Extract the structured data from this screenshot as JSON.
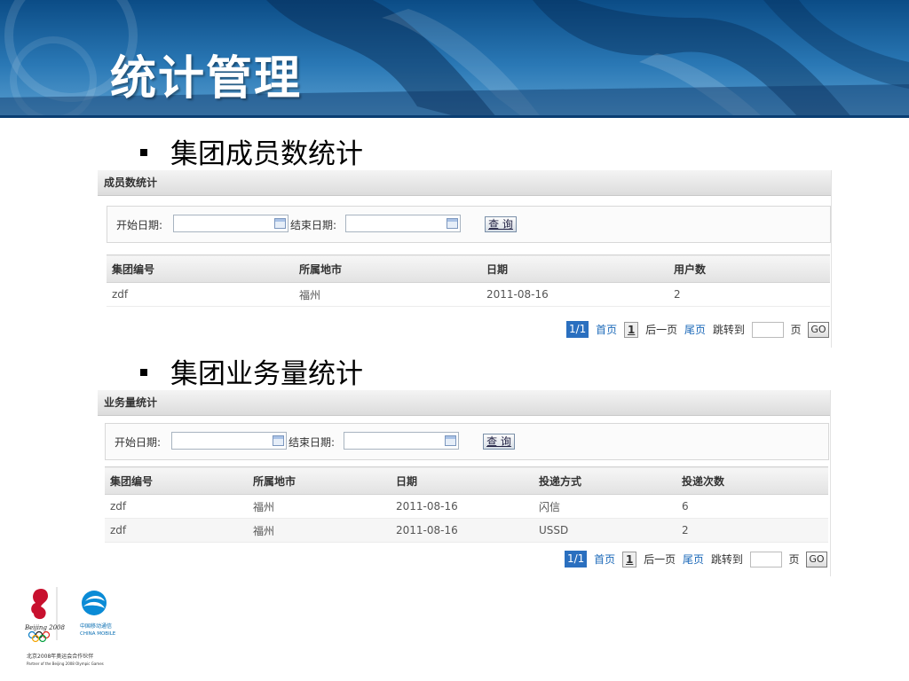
{
  "slide": {
    "title": "统计管理"
  },
  "sections": [
    {
      "bullet": "集团成员数统计",
      "panel_title": "成员数统计",
      "start_label": "开始日期:",
      "end_label": "结束日期:",
      "query_label": "查 询",
      "columns": [
        "集团编号",
        "所属地市",
        "日期",
        "用户数"
      ],
      "rows": [
        [
          "zdf",
          "福州",
          "2011-08-16",
          "2"
        ]
      ],
      "pager": {
        "current": "1/1",
        "first": "首页",
        "page": "1",
        "next": "后一页",
        "last": "尾页",
        "jump": "跳转到",
        "page_unit": "页",
        "go": "GO"
      }
    },
    {
      "bullet": "集团业务量统计",
      "panel_title": "业务量统计",
      "start_label": "开始日期:",
      "end_label": "结束日期:",
      "query_label": "查 询",
      "columns": [
        "集团编号",
        "所属地市",
        "日期",
        "投递方式",
        "投递次数"
      ],
      "rows": [
        [
          "zdf",
          "福州",
          "2011-08-16",
          "闪信",
          "6"
        ],
        [
          "zdf",
          "福州",
          "2011-08-16",
          "USSD",
          "2"
        ]
      ],
      "pager": {
        "current": "1/1",
        "first": "首页",
        "page": "1",
        "next": "后一页",
        "last": "尾页",
        "jump": "跳转到",
        "page_unit": "页",
        "go": "GO"
      }
    }
  ],
  "footer": {
    "beijing_logo_text": "Beijing 2008",
    "mobile_logo_cn": "中国移动通信",
    "mobile_logo_en": "CHINA MOBILE",
    "partner_cn": "北京2008年奥运会合作伙伴",
    "partner_en": "Partner of the Beijing 2008 Olympic Games"
  },
  "colors": {
    "banner": "#1d5f9c",
    "accent": "#2a6fbf",
    "link": "#1a68b8"
  }
}
